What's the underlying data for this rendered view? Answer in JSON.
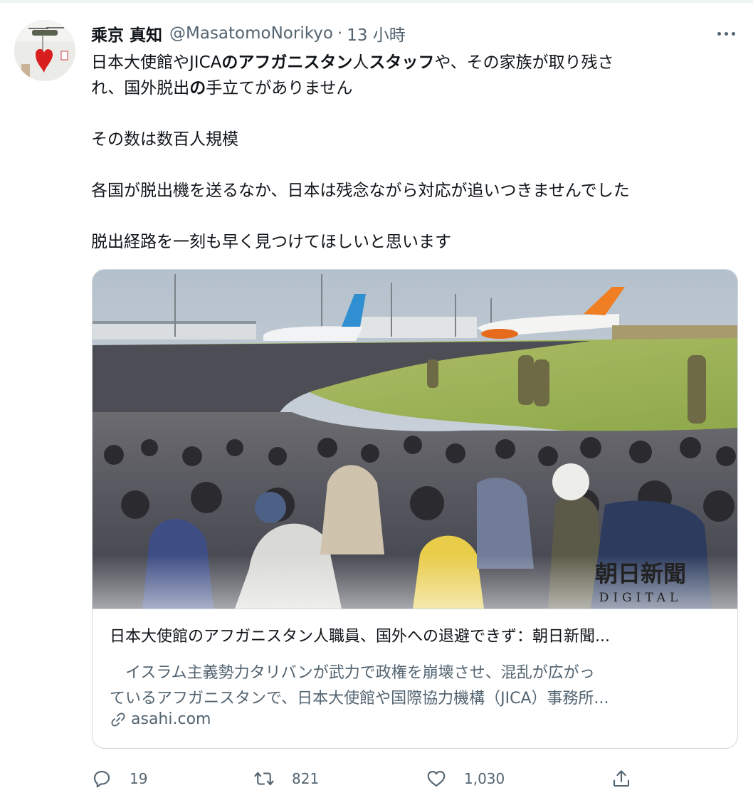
{
  "tweet": {
    "author_name": "乘京 真知",
    "handle": "@MasatomoNorikyo",
    "separator": "·",
    "time": "13 小時",
    "body": {
      "l1": [
        {
          "t": "日本大使館やJICA",
          "b": false
        },
        {
          "t": "のアフガニスタン",
          "b": true
        },
        {
          "t": "人",
          "b": false
        },
        {
          "t": "スタッフ",
          "b": true
        },
        {
          "t": "や、その家族が取り残さ",
          "b": false
        }
      ],
      "l2": [
        {
          "t": "れ、国外脱出",
          "b": false
        },
        {
          "t": "の",
          "b": true
        },
        {
          "t": "手立てがありません",
          "b": false
        }
      ],
      "p2": "その数は数百人規模",
      "p3": "各国が脱出機を送るなか、日本は残念ながら対応が追いつきませんでした",
      "p4": "脱出経路を一刻も早く見つけてほしいと思います"
    }
  },
  "card": {
    "watermark_title": "朝日新聞",
    "watermark_sub": "DIGITAL",
    "title": "日本大使館のアフガニスタン人職員、国外への退避できず：朝日新聞...",
    "desc_line1": "イスラム主義勢力タリバンが武力で政権を崩壊させ、混乱が広がっ",
    "desc_line2": "ているアフガニスタンで、日本大使館や国際協力機構（JICA）事務所...",
    "domain": "asahi.com"
  },
  "actions": {
    "replies": "19",
    "retweets": "821",
    "likes": "1,030"
  },
  "colors": {
    "text": "#0f1419",
    "secondary": "#536471",
    "border": "#cfd9de",
    "sky": "#c9d2da",
    "grass": "#9fb55a"
  },
  "icons": [
    "more-icon",
    "reply-icon",
    "retweet-icon",
    "like-icon",
    "share-icon",
    "link-icon"
  ]
}
